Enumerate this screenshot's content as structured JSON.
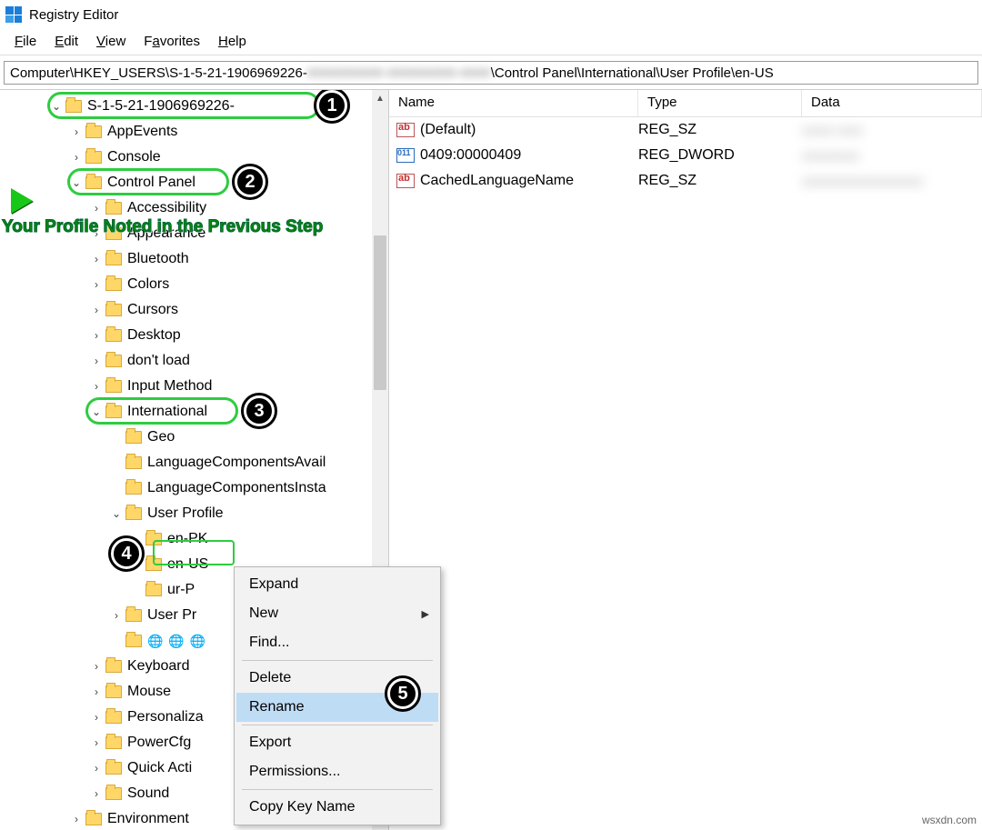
{
  "title": "Registry Editor",
  "menu": {
    "file": "File",
    "edit": "Edit",
    "view": "View",
    "favorites": "Favorites",
    "help": "Help"
  },
  "address": {
    "prefix": "Computer\\HKEY_USERS\\S-1-5-21-1906969226-",
    "suffix": "\\Control Panel\\International\\User Profile\\en-US"
  },
  "annotation": "Your Profile Noted in the Previous Step",
  "tree": {
    "sid": "S-1-5-21-1906969226-",
    "sid_children": [
      "AppEvents",
      "Console"
    ],
    "cpanel": "Control Panel",
    "cpanel_children": [
      "Accessibility",
      "Appearance",
      "Bluetooth",
      "Colors",
      "Cursors",
      "Desktop",
      "don't load",
      "Input Method"
    ],
    "intl": "International",
    "intl_children": [
      "Geo",
      "LanguageComponentsAvail",
      "LanguageComponentsInsta"
    ],
    "userprofile": "User Profile",
    "up_children": [
      "en-PK",
      "en-US",
      "ur-P"
    ],
    "after_up": "User Pr",
    "globes": "🌐 🌐 🌐",
    "tail": [
      "Keyboard",
      "Mouse",
      "Personaliza",
      "PowerCfg",
      "Quick Acti",
      "Sound"
    ],
    "env": "Environment"
  },
  "list": {
    "headers": {
      "name": "Name",
      "type": "Type",
      "data": "Data"
    },
    "rows": [
      {
        "icon": "ab",
        "name": "(Default)",
        "type": "REG_SZ",
        "data": "xxxxx xxxx"
      },
      {
        "icon": "dw",
        "name": "0409:00000409",
        "type": "REG_DWORD",
        "data": "xxxxxxxxx"
      },
      {
        "icon": "ab",
        "name": "CachedLanguageName",
        "type": "REG_SZ",
        "data": "xxxxxxxxxxxxxxxxxxx"
      }
    ]
  },
  "context": {
    "expand": "Expand",
    "new": "New",
    "find": "Find...",
    "delete": "Delete",
    "rename": "Rename",
    "export": "Export",
    "permissions": "Permissions...",
    "copykey": "Copy Key Name"
  },
  "badges": [
    "1",
    "2",
    "3",
    "4",
    "5"
  ],
  "watermark": "wsxdn.com"
}
